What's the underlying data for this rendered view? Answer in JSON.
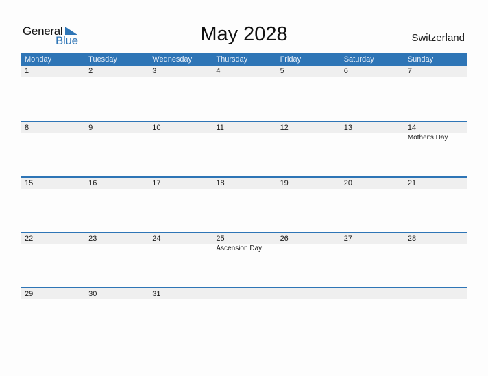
{
  "logo": {
    "word1": "General",
    "word2": "Blue",
    "accent_color": "#2e75b6"
  },
  "title": "May 2028",
  "country": "Switzerland",
  "header_color": "#2e75b6",
  "weekdays": [
    "Monday",
    "Tuesday",
    "Wednesday",
    "Thursday",
    "Friday",
    "Saturday",
    "Sunday"
  ],
  "weeks": [
    [
      {
        "day": "1",
        "holiday": ""
      },
      {
        "day": "2",
        "holiday": ""
      },
      {
        "day": "3",
        "holiday": ""
      },
      {
        "day": "4",
        "holiday": ""
      },
      {
        "day": "5",
        "holiday": ""
      },
      {
        "day": "6",
        "holiday": ""
      },
      {
        "day": "7",
        "holiday": ""
      }
    ],
    [
      {
        "day": "8",
        "holiday": ""
      },
      {
        "day": "9",
        "holiday": ""
      },
      {
        "day": "10",
        "holiday": ""
      },
      {
        "day": "11",
        "holiday": ""
      },
      {
        "day": "12",
        "holiday": ""
      },
      {
        "day": "13",
        "holiday": ""
      },
      {
        "day": "14",
        "holiday": "Mother's Day"
      }
    ],
    [
      {
        "day": "15",
        "holiday": ""
      },
      {
        "day": "16",
        "holiday": ""
      },
      {
        "day": "17",
        "holiday": ""
      },
      {
        "day": "18",
        "holiday": ""
      },
      {
        "day": "19",
        "holiday": ""
      },
      {
        "day": "20",
        "holiday": ""
      },
      {
        "day": "21",
        "holiday": ""
      }
    ],
    [
      {
        "day": "22",
        "holiday": ""
      },
      {
        "day": "23",
        "holiday": ""
      },
      {
        "day": "24",
        "holiday": ""
      },
      {
        "day": "25",
        "holiday": "Ascension Day"
      },
      {
        "day": "26",
        "holiday": ""
      },
      {
        "day": "27",
        "holiday": ""
      },
      {
        "day": "28",
        "holiday": ""
      }
    ],
    [
      {
        "day": "29",
        "holiday": ""
      },
      {
        "day": "30",
        "holiday": ""
      },
      {
        "day": "31",
        "holiday": ""
      },
      {
        "day": "",
        "holiday": ""
      },
      {
        "day": "",
        "holiday": ""
      },
      {
        "day": "",
        "holiday": ""
      },
      {
        "day": "",
        "holiday": ""
      }
    ]
  ]
}
